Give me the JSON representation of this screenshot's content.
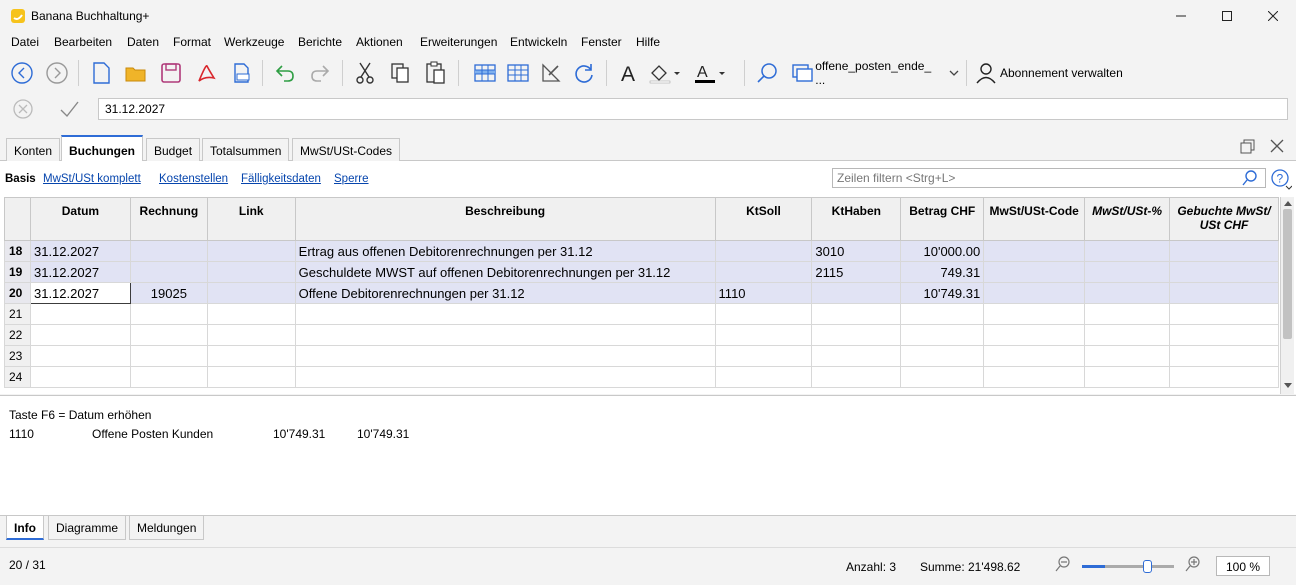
{
  "window": {
    "title": "Banana Buchhaltung+"
  },
  "menu": [
    {
      "label": "Datei"
    },
    {
      "label": "Bearbeiten"
    },
    {
      "label": "Daten"
    },
    {
      "label": "Format"
    },
    {
      "label": "Werkzeuge"
    },
    {
      "label": "Berichte"
    },
    {
      "label": "Aktionen"
    },
    {
      "label": "Erweiterungen"
    },
    {
      "label": "Entwickeln"
    },
    {
      "label": "Fenster"
    },
    {
      "label": "Hilfe"
    }
  ],
  "toolbar": {
    "file_combo": "offene_posten_ende_ ...",
    "subscription_label": "Abonnement verwalten"
  },
  "editline": {
    "value": "31.12.2027"
  },
  "tabs": [
    "Konten",
    "Buchungen",
    "Budget",
    "Totalsummen",
    "MwSt/USt-Codes"
  ],
  "views": {
    "current": "Basis",
    "links": [
      "MwSt/USt komplett",
      "Kostenstellen",
      "Fälligkeitsdaten",
      "Sperre"
    ],
    "filter_placeholder": "Zeilen filtern <Strg+L>"
  },
  "table": {
    "columns": [
      "Datum",
      "Rechnung",
      "Link",
      "Beschreibung",
      "KtSoll",
      "KtHaben",
      "Betrag CHF",
      "MwSt/USt-Code",
      "MwSt/USt-%",
      "Gebuchte MwSt/ USt CHF"
    ],
    "rows": [
      {
        "n": "18",
        "datum": "31.12.2027",
        "rechnung": "",
        "link": "",
        "beschreibung": "Ertrag aus offenen Debitorenrechnungen per 31.12",
        "soll": "",
        "haben": "3010",
        "betrag": "10'000.00",
        "code": "",
        "pct": "",
        "gebucht": ""
      },
      {
        "n": "19",
        "datum": "31.12.2027",
        "rechnung": "",
        "link": "",
        "beschreibung": "Geschuldete MWST auf offenen Debitorenrechnungen per 31.12",
        "soll": "",
        "haben": "2115",
        "betrag": "749.31",
        "code": "",
        "pct": "",
        "gebucht": ""
      },
      {
        "n": "20",
        "datum": "31.12.2027",
        "rechnung": "19025",
        "link": "",
        "beschreibung": "Offene Debitorenrechnungen per 31.12",
        "soll": "1110",
        "haben": "",
        "betrag": "10'749.31",
        "code": "",
        "pct": "",
        "gebucht": ""
      },
      {
        "n": "21",
        "datum": "",
        "rechnung": "",
        "link": "",
        "beschreibung": "",
        "soll": "",
        "haben": "",
        "betrag": "",
        "code": "",
        "pct": "",
        "gebucht": ""
      },
      {
        "n": "22",
        "datum": "",
        "rechnung": "",
        "link": "",
        "beschreibung": "",
        "soll": "",
        "haben": "",
        "betrag": "",
        "code": "",
        "pct": "",
        "gebucht": ""
      },
      {
        "n": "23",
        "datum": "",
        "rechnung": "",
        "link": "",
        "beschreibung": "",
        "soll": "",
        "haben": "",
        "betrag": "",
        "code": "",
        "pct": "",
        "gebucht": ""
      },
      {
        "n": "24",
        "datum": "",
        "rechnung": "",
        "link": "",
        "beschreibung": "",
        "soll": "",
        "haben": "",
        "betrag": "",
        "code": "",
        "pct": "",
        "gebucht": ""
      }
    ]
  },
  "info": {
    "hint": "Taste F6 = Datum erhöhen",
    "account": "1110",
    "account_name": "Offene Posten Kunden",
    "value1": "10'749.31",
    "value2": "10'749.31"
  },
  "bottom_tabs": [
    "Info",
    "Diagramme",
    "Meldungen"
  ],
  "status": {
    "position": "20 / 31",
    "anzahl": "Anzahl: 3",
    "summe": "Summe: 21'498.62",
    "zoom": "100 %",
    "zoom_fraction": 0.25
  },
  "colors": {
    "accent": "#2e6cd6",
    "selection": "#e1e3f4",
    "link": "#0645ad"
  }
}
